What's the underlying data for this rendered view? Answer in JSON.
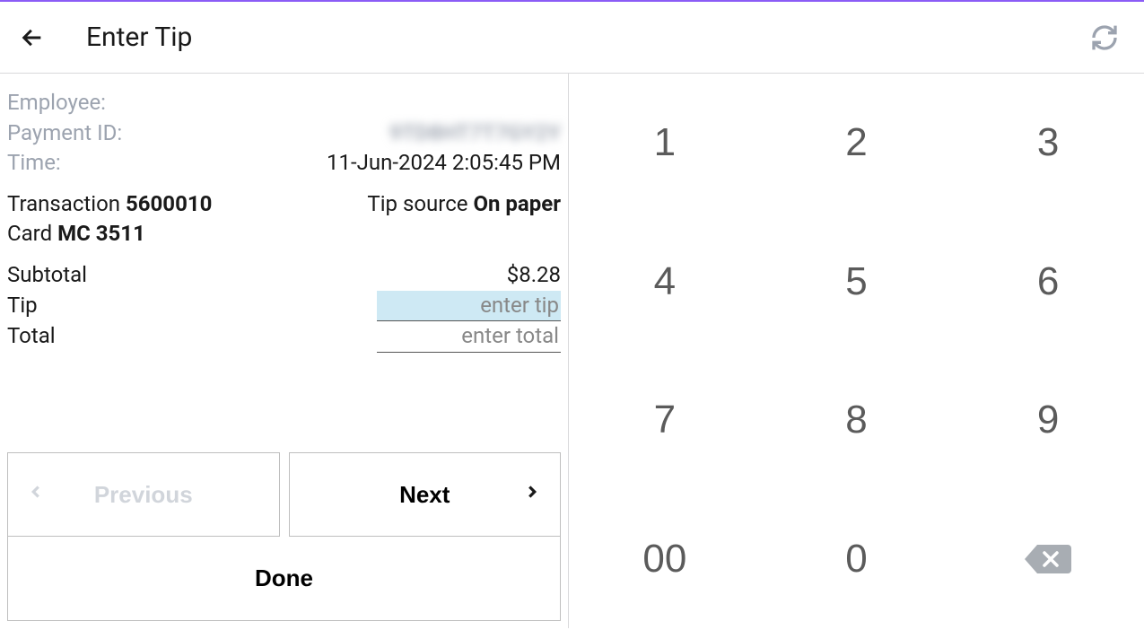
{
  "header": {
    "title": "Enter Tip"
  },
  "details": {
    "employee_label": "Employee:",
    "employee_value": "",
    "payment_id_label": "Payment ID:",
    "payment_id_value": "9TD8HT7T7GY2Y",
    "time_label": "Time:",
    "time_value": "11-Jun-2024 2:05:45 PM",
    "transaction_label": "Transaction",
    "transaction_value": "5600010",
    "tip_source_label": "Tip source",
    "tip_source_value": "On paper",
    "card_label": "Card",
    "card_value": "MC 3511",
    "subtotal_label": "Subtotal",
    "subtotal_value": "$8.28",
    "tip_label": "Tip",
    "tip_placeholder": "enter tip",
    "total_label": "Total",
    "total_placeholder": "enter total"
  },
  "buttons": {
    "previous": "Previous",
    "next": "Next",
    "done": "Done"
  },
  "keypad": {
    "k1": "1",
    "k2": "2",
    "k3": "3",
    "k4": "4",
    "k5": "5",
    "k6": "6",
    "k7": "7",
    "k8": "8",
    "k9": "9",
    "k00": "00",
    "k0": "0"
  }
}
